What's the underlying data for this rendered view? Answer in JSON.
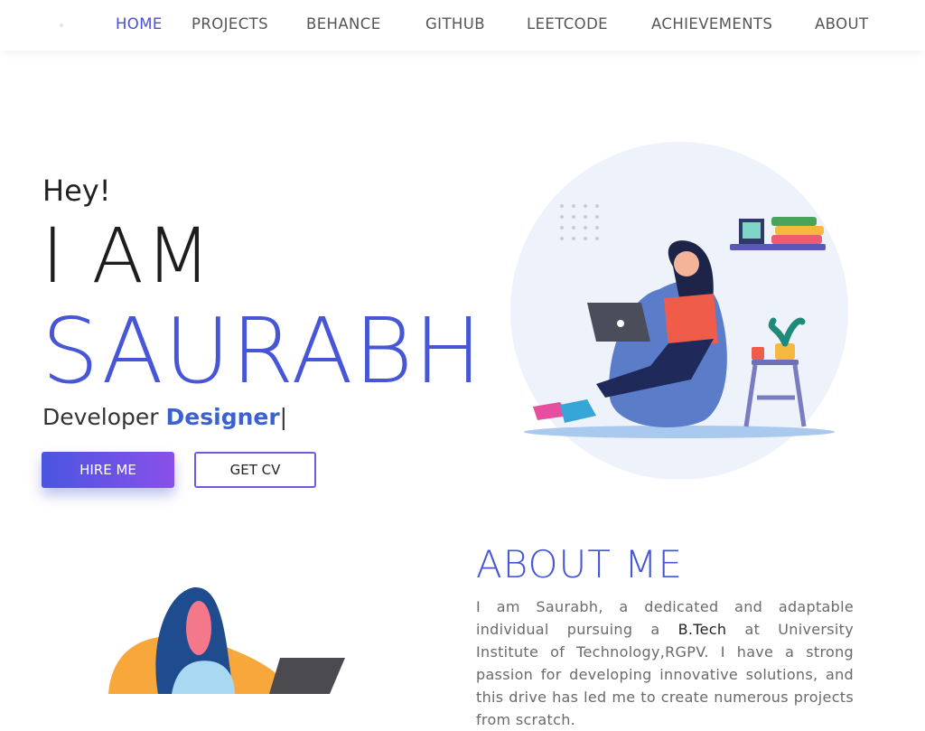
{
  "nav": {
    "items": [
      {
        "label": "HOME",
        "active": true
      },
      {
        "label": "PROJECTS"
      },
      {
        "label": "BEHANCE"
      },
      {
        "label": "GITHUB"
      },
      {
        "label": "LEETCODE"
      },
      {
        "label": "ACHIEVEMENTS"
      },
      {
        "label": "ABOUT"
      }
    ]
  },
  "hero": {
    "greeting": "Hey!",
    "intro": "I AM",
    "name": "SAURABH",
    "role_plain": "Developer ",
    "role_accent": "Designer",
    "cursor": "|",
    "hire_label": "HIRE ME",
    "cv_label": "GET CV"
  },
  "about": {
    "title": "ABOUT ME",
    "text_before": "I am Saurabh, a dedicated and adaptable individual pursuing a ",
    "text_highlight": "B.Tech",
    "text_after": " at University Institute of Technology,RGPV. I have a strong passion for developing innovative solutions, and this drive has led me to create numerous projects from scratch."
  },
  "colors": {
    "accent": "#4656d6",
    "nav_active": "#4a4fd9",
    "gradient_start": "#4a55e0",
    "gradient_end": "#8a50ea"
  }
}
